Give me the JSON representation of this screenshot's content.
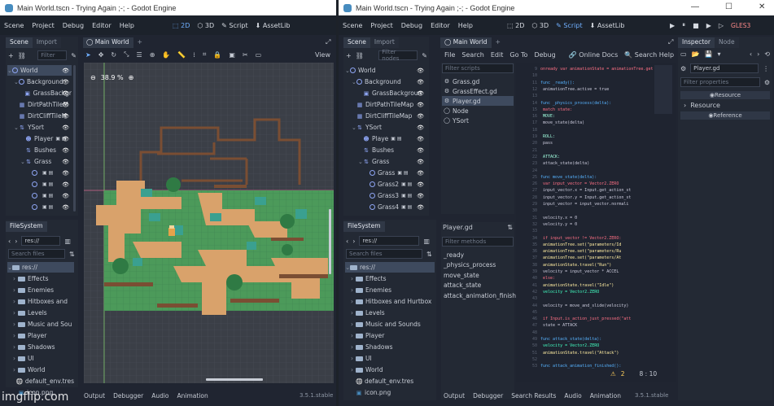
{
  "left": {
    "title": "Main World.tscn - Trying Again ;-; - Godot Engine",
    "menus": [
      "Scene",
      "Project",
      "Debug",
      "Editor",
      "Help"
    ],
    "workspaces": [
      "2D",
      "3D",
      "Script",
      "AssetLib"
    ],
    "dock_tabs": [
      "Scene",
      "Import"
    ],
    "filter_placeholder": "Filter",
    "scene_tree": [
      {
        "label": "World",
        "depth": 0,
        "icon": "node-2d-icon",
        "selected": true
      },
      {
        "label": "Background",
        "depth": 1,
        "icon": "node-2d-icon"
      },
      {
        "label": "GrassBackgr",
        "depth": 2,
        "icon": "sprite-icon"
      },
      {
        "label": "DirtPathTileM",
        "depth": 1,
        "icon": "tilemap-icon"
      },
      {
        "label": "DirtCliffTileM",
        "depth": 1,
        "icon": "tilemap-icon"
      },
      {
        "label": "YSort",
        "depth": 1,
        "icon": "ysort-icon"
      },
      {
        "label": "Player",
        "depth": 2,
        "icon": "player-icon"
      },
      {
        "label": "Bushes",
        "depth": 2,
        "icon": "ysort-icon"
      },
      {
        "label": "Grass",
        "depth": 2,
        "icon": "ysort-icon"
      },
      {
        "label": "",
        "depth": 3,
        "icon": "node-2d-icon"
      },
      {
        "label": "",
        "depth": 3,
        "icon": "node-2d-icon"
      },
      {
        "label": "",
        "depth": 3,
        "icon": "node-2d-icon"
      },
      {
        "label": "",
        "depth": 3,
        "icon": "node-2d-icon"
      }
    ],
    "editor_tab": "Main World",
    "view_button": "View",
    "zoom": "38.9 %",
    "filesystem_title": "FileSystem",
    "path": "res://",
    "search_placeholder": "Search files",
    "files": [
      {
        "label": "res://",
        "type": "folder-open",
        "depth": 0,
        "selected": true
      },
      {
        "label": "Effects",
        "type": "folder",
        "depth": 1
      },
      {
        "label": "Enemies",
        "type": "folder",
        "depth": 1
      },
      {
        "label": "Hitboxes and",
        "type": "folder",
        "depth": 1
      },
      {
        "label": "Levels",
        "type": "folder",
        "depth": 1
      },
      {
        "label": "Music and Sou",
        "type": "folder",
        "depth": 1
      },
      {
        "label": "Player",
        "type": "folder",
        "depth": 1
      },
      {
        "label": "Shadows",
        "type": "folder",
        "depth": 1
      },
      {
        "label": "UI",
        "type": "folder",
        "depth": 1
      },
      {
        "label": "World",
        "type": "folder",
        "depth": 1
      },
      {
        "label": "default_env.tres",
        "type": "env",
        "depth": 1
      },
      {
        "label": "icon.png",
        "type": "image",
        "depth": 1
      }
    ],
    "bottom_tabs": [
      "Output",
      "Debugger",
      "Audio",
      "Animation"
    ],
    "version": "3.5.1.stable"
  },
  "right": {
    "title": "Main World.tscn - Trying Again ;-; - Godot Engine",
    "menus": [
      "Scene",
      "Project",
      "Debug",
      "Editor",
      "Help"
    ],
    "workspaces": [
      "2D",
      "3D",
      "Script",
      "AssetLib"
    ],
    "renderer": "GLES3",
    "dock_tabs": [
      "Scene",
      "Import"
    ],
    "filter_placeholder": "Filter nodes",
    "scene_tree": [
      {
        "label": "World",
        "depth": 0,
        "icon": "node-2d-icon"
      },
      {
        "label": "Background",
        "depth": 1,
        "icon": "node-2d-icon"
      },
      {
        "label": "GrassBackgroun",
        "depth": 2,
        "icon": "sprite-icon"
      },
      {
        "label": "DirtPathTileMap",
        "depth": 1,
        "icon": "tilemap-icon"
      },
      {
        "label": "DirtCliffTileMap",
        "depth": 1,
        "icon": "tilemap-icon"
      },
      {
        "label": "YSort",
        "depth": 1,
        "icon": "ysort-icon"
      },
      {
        "label": "Playe",
        "depth": 2,
        "icon": "player-icon"
      },
      {
        "label": "Bushes",
        "depth": 2,
        "icon": "ysort-icon"
      },
      {
        "label": "Grass",
        "depth": 2,
        "icon": "ysort-icon"
      },
      {
        "label": "Grass",
        "depth": 3,
        "icon": "node-2d-icon"
      },
      {
        "label": "Grass2",
        "depth": 3,
        "icon": "node-2d-icon"
      },
      {
        "label": "Grass3",
        "depth": 3,
        "icon": "node-2d-icon"
      },
      {
        "label": "Grass4",
        "depth": 3,
        "icon": "node-2d-icon"
      }
    ],
    "editor_tab": "Main World",
    "script_menus": [
      "File",
      "Search",
      "Edit",
      "Go To",
      "Debug"
    ],
    "online_docs": "Online Docs",
    "search_help": "Search Help",
    "filter_scripts_placeholder": "Filter scripts",
    "scripts": [
      {
        "label": "Grass.gd",
        "selected": false
      },
      {
        "label": "GrassEffect.gd",
        "selected": false
      },
      {
        "label": "Player.gd",
        "selected": true
      },
      {
        "label": "Node",
        "selected": false
      },
      {
        "label": "YSort",
        "selected": false
      }
    ],
    "current_script": "Player.gd",
    "filter_methods_placeholder": "Filter methods",
    "methods": [
      "_ready",
      "_physics_process",
      "move_state",
      "attack_state",
      "attack_animation_finished"
    ],
    "filesystem_title": "FileSystem",
    "path": "res://",
    "search_placeholder": "Search files",
    "files": [
      {
        "label": "res://",
        "type": "folder-open",
        "depth": 0,
        "selected": true
      },
      {
        "label": "Effects",
        "type": "folder",
        "depth": 1
      },
      {
        "label": "Enemies",
        "type": "folder",
        "depth": 1
      },
      {
        "label": "Hitboxes and Hurtbox",
        "type": "folder",
        "depth": 1
      },
      {
        "label": "Levels",
        "type": "folder",
        "depth": 1
      },
      {
        "label": "Music and Sounds",
        "type": "folder",
        "depth": 1
      },
      {
        "label": "Player",
        "type": "folder",
        "depth": 1
      },
      {
        "label": "Shadows",
        "type": "folder",
        "depth": 1
      },
      {
        "label": "UI",
        "type": "folder",
        "depth": 1
      },
      {
        "label": "World",
        "type": "folder",
        "depth": 1
      },
      {
        "label": "default_env.tres",
        "type": "env",
        "depth": 1
      },
      {
        "label": "icon.png",
        "type": "image",
        "depth": 1
      }
    ],
    "inspector_tabs": [
      "Inspector",
      "Node"
    ],
    "inspector_object": "Player.gd",
    "filter_properties_placeholder": "Filter properties",
    "resource_button": "Resource",
    "resource_section": "Resource",
    "reference_button": "Reference",
    "warnings": "2",
    "cursor": "8 : 10",
    "bottom_tabs": [
      "Output",
      "Debugger",
      "Search Results",
      "Audio",
      "Animation"
    ],
    "version": "3.5.1.stable",
    "code": [
      {
        "n": "9",
        "t": "onready var animationState = animationTree.get"
      },
      {
        "n": "10",
        "t": ""
      },
      {
        "n": "11",
        "t": "func _ready():"
      },
      {
        "n": "12",
        "t": "    animationTree.active = true"
      },
      {
        "n": "13",
        "t": ""
      },
      {
        "n": "14",
        "t": "func _physics_process(delta):"
      },
      {
        "n": "15",
        "t": "    match state:"
      },
      {
        "n": "16",
        "t": "        MOVE:"
      },
      {
        "n": "17",
        "t": "            move_state(delta)"
      },
      {
        "n": "18",
        "t": ""
      },
      {
        "n": "19",
        "t": "        ROLL:"
      },
      {
        "n": "20",
        "t": "            pass"
      },
      {
        "n": "21",
        "t": ""
      },
      {
        "n": "22",
        "t": "        ATTACK:"
      },
      {
        "n": "23",
        "t": "            attack_state(delta)"
      },
      {
        "n": "24",
        "t": ""
      },
      {
        "n": "25",
        "t": "func move_state(delta):"
      },
      {
        "n": "26",
        "t": "    var input_vector = Vector2.ZERO"
      },
      {
        "n": "27",
        "t": "    input_vector.x = Input.get_action_st"
      },
      {
        "n": "28",
        "t": "    input_vector.y = Input.get_action_st"
      },
      {
        "n": "29",
        "t": "    input_vector = input_vector.normali"
      },
      {
        "n": "30",
        "t": ""
      },
      {
        "n": "31",
        "t": "    velocity.x = 0"
      },
      {
        "n": "32",
        "t": "    velocity.y = 0"
      },
      {
        "n": "33",
        "t": ""
      },
      {
        "n": "34",
        "t": "    if input_vector != Vector2.ZERO:"
      },
      {
        "n": "35",
        "t": "        animationTree.set(\"parameters/Id"
      },
      {
        "n": "36",
        "t": "        animationTree.set(\"parameters/Ru"
      },
      {
        "n": "37",
        "t": "        animationTree.set(\"parameters/At"
      },
      {
        "n": "38",
        "t": "        animationState.travel(\"Run\")"
      },
      {
        "n": "39",
        "t": "        velocity = input_vector * ACCEL"
      },
      {
        "n": "40",
        "t": "    else:"
      },
      {
        "n": "41",
        "t": "        animationState.travel(\"Idle\")"
      },
      {
        "n": "42",
        "t": "        velocity = Vector2.ZERO"
      },
      {
        "n": "43",
        "t": ""
      },
      {
        "n": "44",
        "t": "    velocity = move_and_slide(velocity)"
      },
      {
        "n": "45",
        "t": ""
      },
      {
        "n": "46",
        "t": "    if Input.is_action_just_pressed(\"att"
      },
      {
        "n": "47",
        "t": "        state = ATTACK"
      },
      {
        "n": "48",
        "t": ""
      },
      {
        "n": "49",
        "t": "func attack_state(delta):"
      },
      {
        "n": "50",
        "t": "    velocity = Vector2.ZERO"
      },
      {
        "n": "51",
        "t": "    animationState.travel(\"Attack\")"
      },
      {
        "n": "52",
        "t": ""
      },
      {
        "n": "53",
        "t": "func attack_animation_finished():"
      }
    ]
  },
  "watermark": "imgflip.com",
  "colors": {
    "accent": "#478cbf",
    "selection": "#3e4a5e",
    "grass": "#4c9a5a",
    "dirt": "#d9a26b",
    "cliff": "#7a4e33",
    "bush": "#2f7a44",
    "keyword": "#ff7085"
  }
}
